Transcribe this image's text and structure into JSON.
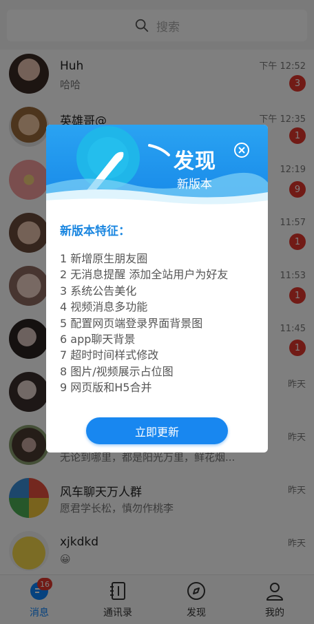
{
  "search": {
    "placeholder": "搜索"
  },
  "conversations": [
    {
      "name": "Huh",
      "preview": "哈哈",
      "time": "下午 12:52",
      "badge": "3"
    },
    {
      "name": "英雄哥@",
      "preview": "",
      "time": "下午 12:35",
      "badge": "1"
    },
    {
      "name": "",
      "preview": "",
      "time": "12:19",
      "badge": "9"
    },
    {
      "name": "",
      "preview": "",
      "time": "11:57",
      "badge": "1"
    },
    {
      "name": "",
      "preview": "",
      "time": "11:53",
      "badge": "1"
    },
    {
      "name": "",
      "preview": "",
      "time": "11:45",
      "badge": "1"
    },
    {
      "name": "",
      "preview": "",
      "time": "昨天",
      "badge": ""
    },
    {
      "name": "",
      "preview": "无论到哪里，都是阳光万里，鲜花烟...",
      "time": "昨天",
      "badge": ""
    },
    {
      "name": "风车聊天万人群",
      "preview": "愿君学长松，慎勿作桃李",
      "time": "昨天",
      "badge": ""
    },
    {
      "name": "xjkdkd",
      "preview": "😀",
      "time": "昨天",
      "badge": ""
    }
  ],
  "tabbar": {
    "tabs": [
      {
        "label": "消息",
        "icon": "message-icon",
        "active": true,
        "badge": "16"
      },
      {
        "label": "通讯录",
        "icon": "contacts-icon",
        "active": false,
        "badge": ""
      },
      {
        "label": "发现",
        "icon": "compass-icon",
        "active": false,
        "badge": ""
      },
      {
        "label": "我的",
        "icon": "person-icon",
        "active": false,
        "badge": ""
      }
    ]
  },
  "modal": {
    "title": "发现",
    "subtitle": "新版本",
    "heading": "新版本特征：",
    "features": [
      "1 新增原生朋友圈",
      "2 无消息提醒 添加全站用户为好友",
      "3 系统公告美化",
      "4 视频消息多功能",
      "5 配置网页端登录界面背景图",
      "6 app聊天背景",
      "7 超时时间样式修改",
      "8 图片/视频展示占位图",
      "9 网页版和H5合并"
    ],
    "button_label": "立即更新"
  },
  "colors": {
    "accent": "#1887f0",
    "badge": "#e2372d",
    "heading": "#1a86e0"
  }
}
